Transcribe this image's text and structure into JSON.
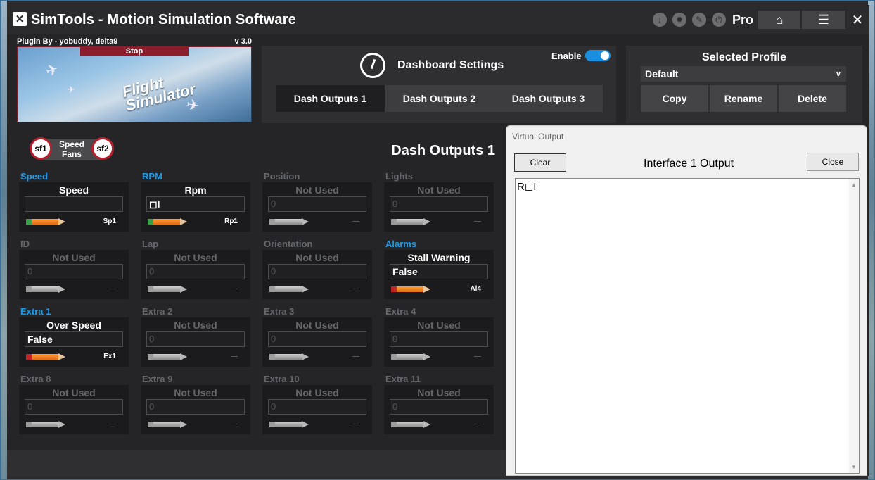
{
  "window": {
    "app_name": "SimTools",
    "title": " - Motion Simulation Software",
    "edition": "Pro",
    "home_glyph": "⌂",
    "menu_glyph": "☰",
    "close_glyph": "✕",
    "status_icons": [
      "download-icon",
      "settings-burst-icon",
      "wrench-icon",
      "power-icon"
    ]
  },
  "plugin": {
    "by_label": "Plugin By - yobuddy, delta9",
    "version": "v 3.0",
    "stop_label": "Stop",
    "image_title_line1": "Flight",
    "image_title_line2": "Simulator"
  },
  "dashboard": {
    "title": "Dashboard Settings",
    "enable_label": "Enable",
    "enabled": true,
    "tabs": [
      {
        "label": "Dash Outputs 1",
        "active": true
      },
      {
        "label": "Dash Outputs 2",
        "active": false
      },
      {
        "label": "Dash Outputs 3",
        "active": false
      }
    ]
  },
  "profile": {
    "title": "Selected Profile",
    "selected": "Default",
    "chevron": "v",
    "buttons": [
      "Copy",
      "Rename",
      "Delete"
    ]
  },
  "fans": {
    "left": "sf1",
    "label_line1": "Speed",
    "label_line2": "Fans",
    "right": "sf2"
  },
  "main": {
    "heading": "Dash Outputs 1",
    "cells": [
      {
        "label": "Speed",
        "title": "Speed",
        "value": "",
        "code": "Sp1",
        "on": true
      },
      {
        "label": "RPM",
        "title": "Rpm",
        "value": "◻I",
        "code": "Rp1",
        "on": true
      },
      {
        "label": "Position",
        "title": "Not Used",
        "value": "0",
        "code": "—",
        "on": false
      },
      {
        "label": "Lights",
        "title": "Not Used",
        "value": "0",
        "code": "—",
        "on": false
      },
      {
        "label": "ID",
        "title": "Not Used",
        "value": "0",
        "code": "—",
        "on": false
      },
      {
        "label": "Lap",
        "title": "Not Used",
        "value": "0",
        "code": "—",
        "on": false
      },
      {
        "label": "Orientation",
        "title": "Not Used",
        "value": "0",
        "code": "—",
        "on": false
      },
      {
        "label": "Alarms",
        "title": "Stall Warning",
        "value": "False",
        "code": "Al4",
        "on": true,
        "alarm": true
      },
      {
        "label": "Extra 1",
        "title": "Over Speed",
        "value": "False",
        "code": "Ex1",
        "on": true,
        "alarm": true
      },
      {
        "label": "Extra 2",
        "title": "Not Used",
        "value": "0",
        "code": "—",
        "on": false
      },
      {
        "label": "Extra 3",
        "title": "Not Used",
        "value": "0",
        "code": "—",
        "on": false
      },
      {
        "label": "Extra 4",
        "title": "Not Used",
        "value": "0",
        "code": "—",
        "on": false
      },
      {
        "label": "Extra 8",
        "title": "Not Used",
        "value": "0",
        "code": "—",
        "on": false
      },
      {
        "label": "Extra 9",
        "title": "Not Used",
        "value": "0",
        "code": "—",
        "on": false
      },
      {
        "label": "Extra 10",
        "title": "Not Used",
        "value": "0",
        "code": "—",
        "on": false
      },
      {
        "label": "Extra 11",
        "title": "Not Used",
        "value": "0",
        "code": "—",
        "on": false
      }
    ]
  },
  "virtual_output": {
    "window_title": "Virtual Output",
    "clear_label": "Clear",
    "heading": "Interface 1 Output",
    "close_label": "Close",
    "text": "R◻I"
  },
  "colors": {
    "accent": "#1e9be8",
    "stop": "#8a1e2c",
    "fan_ring": "#b61f2b"
  }
}
